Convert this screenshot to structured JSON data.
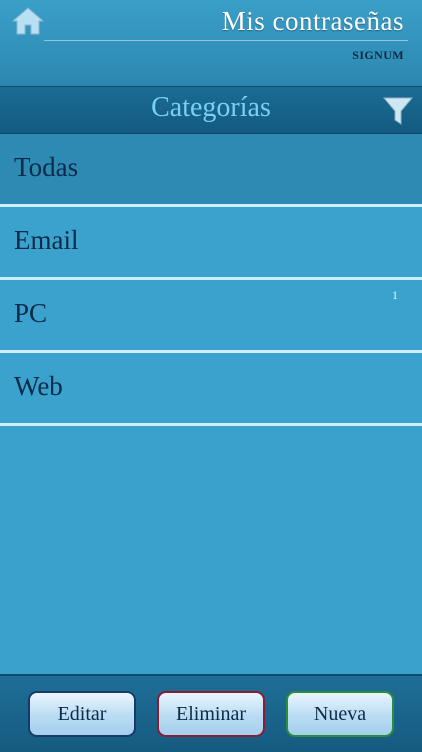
{
  "header": {
    "title": "Mis contraseñas",
    "brand": "SIGNUM",
    "home_icon": "home-icon"
  },
  "section": {
    "title": "Categorías",
    "filter_icon": "filter-icon"
  },
  "categories": [
    {
      "label": "Todas",
      "count": "",
      "selected": true
    },
    {
      "label": "Email",
      "count": ""
    },
    {
      "label": "PC",
      "count": "1"
    },
    {
      "label": "Web",
      "count": ""
    }
  ],
  "toolbar": {
    "edit_label": "Editar",
    "delete_label": "Eliminar",
    "new_label": "Nueva"
  },
  "colors": {
    "background": "#3aa1cc",
    "bar": "#1c6c94",
    "section_title": "#79d0f3",
    "text": "#0d2a48"
  }
}
